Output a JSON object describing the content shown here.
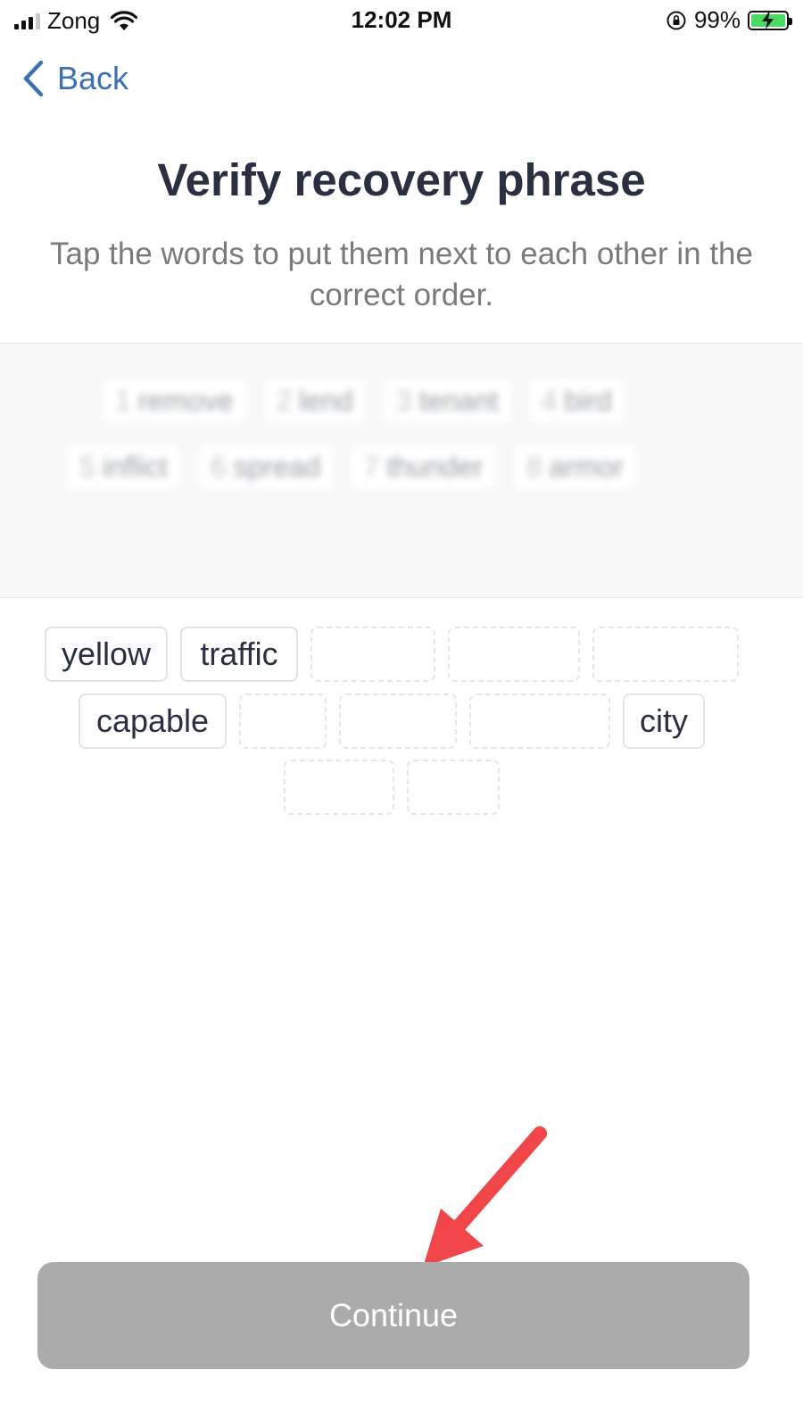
{
  "status_bar": {
    "carrier": "Zong",
    "time": "12:02 PM",
    "battery_percent": "99%",
    "battery_level": 0.99,
    "signal_bars": 3
  },
  "nav": {
    "back_label": "Back",
    "accent_color": "#3d6fb4"
  },
  "header": {
    "title": "Verify recovery phrase",
    "subtitle": "Tap the words to put them next to each other in the correct order."
  },
  "selected_words": [
    {
      "num": "1",
      "word": "remove"
    },
    {
      "num": "2",
      "word": "lend"
    },
    {
      "num": "3",
      "word": "tenant"
    },
    {
      "num": "4",
      "word": "bird"
    },
    {
      "num": "5",
      "word": "inflict"
    },
    {
      "num": "6",
      "word": "spread"
    },
    {
      "num": "7",
      "word": "thunder"
    },
    {
      "num": "8",
      "word": "armor"
    }
  ],
  "word_bank": [
    {
      "word": "yellow"
    },
    {
      "word": "traffic"
    },
    {
      "word": ""
    },
    {
      "word": ""
    },
    {
      "word": ""
    },
    {
      "word": "capable"
    },
    {
      "word": ""
    },
    {
      "word": ""
    },
    {
      "word": ""
    },
    {
      "word": "city"
    },
    {
      "word": ""
    },
    {
      "word": ""
    }
  ],
  "continue_button": {
    "label": "Continue",
    "background": "#ababab"
  },
  "annotation": {
    "arrow_color": "#f0464a"
  }
}
